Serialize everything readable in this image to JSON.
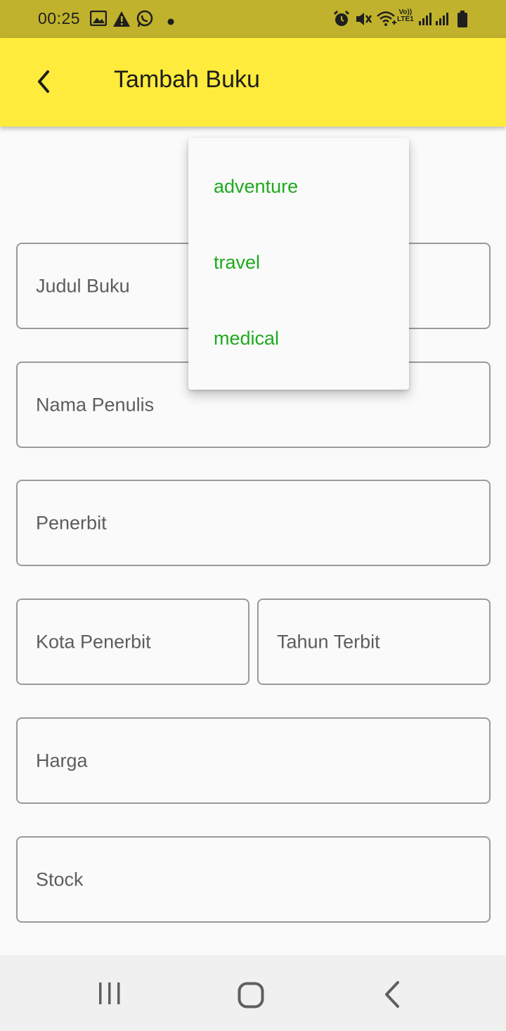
{
  "status_bar": {
    "time": "00:25",
    "left_icons": [
      "gallery-icon",
      "warning-icon",
      "whatsapp-icon",
      "dot-icon"
    ],
    "right_icons": [
      "alarm-icon",
      "mute-icon",
      "wifi-icon",
      "volte-icon",
      "signal-icon",
      "signal-icon",
      "battery-icon"
    ],
    "volte_text_top": "Vo))",
    "volte_text_bottom": "LTE1"
  },
  "app_bar": {
    "title": "Tambah Buku",
    "back_icon": "back-arrow-icon",
    "color": "#ffeb3b"
  },
  "dropdown": {
    "options": [
      "adventure",
      "travel",
      "medical"
    ],
    "option_color": "#1faa1f"
  },
  "form": {
    "judul_buku": "Judul Buku",
    "nama_penulis": "Nama Penulis",
    "penerbit": "Penerbit",
    "kota_penerbit": "Kota Penerbit",
    "tahun_terbit": "Tahun Terbit",
    "harga": "Harga",
    "stock": "Stock"
  },
  "nav_bar": {
    "icons": [
      "recents-icon",
      "home-icon",
      "nav-back-icon"
    ]
  }
}
